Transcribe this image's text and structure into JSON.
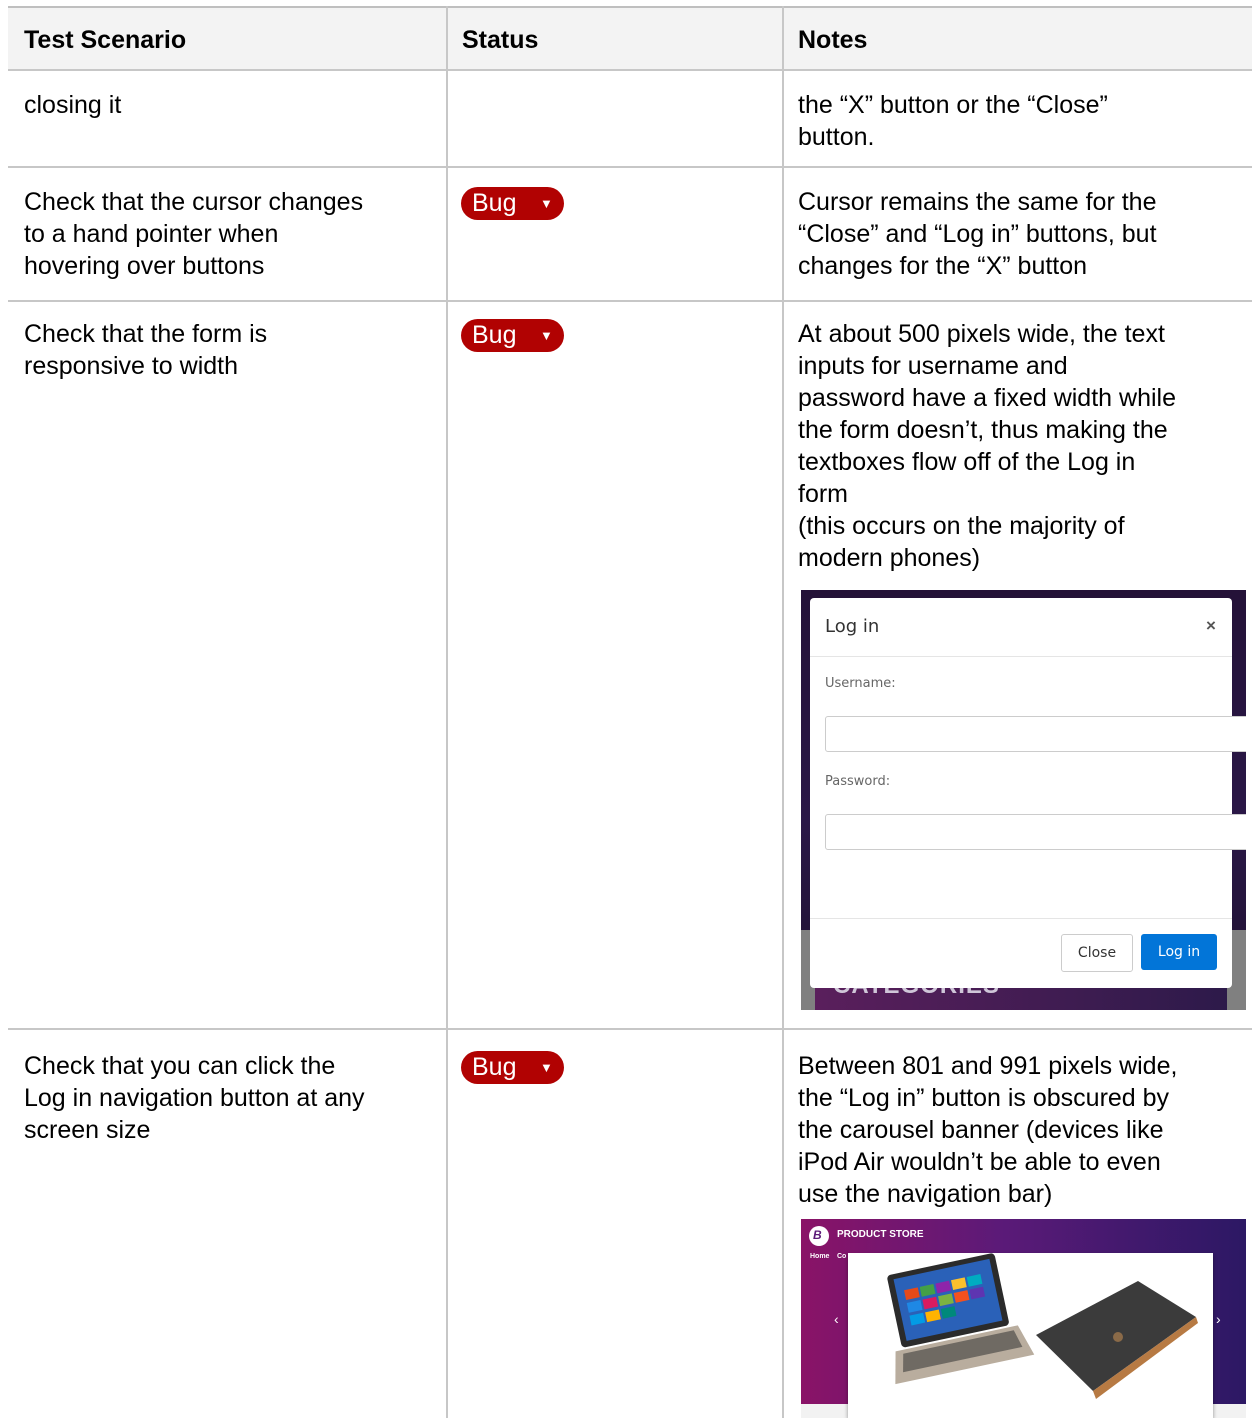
{
  "headers": [
    "Test Scenario",
    "Status",
    "Notes"
  ],
  "rows": [
    {
      "scenario": [
        "closing it"
      ],
      "status": "",
      "notes": [
        "the “X” button or the “Close”",
        "button."
      ]
    },
    {
      "scenario": [
        "Check that the cursor changes",
        "to a hand pointer when",
        "hovering over buttons"
      ],
      "status": "Bug",
      "notes": [
        "Cursor remains the same for the",
        "“Close” and “Log in” buttons, but",
        "changes for the “X” button"
      ]
    },
    {
      "scenario": [
        "Check that the form is",
        "responsive to width"
      ],
      "status": "Bug",
      "notes": [
        "At about 500 pixels wide, the text",
        "inputs for username and",
        "password have a fixed width while",
        "the form doesn’t, thus making the",
        "textboxes flow off of the Log in",
        "form",
        "(this occurs on the majority of",
        "modern phones)"
      ]
    },
    {
      "scenario": [
        "Check that you can click the",
        "Log in navigation button at any",
        "screen size"
      ],
      "status": "Bug",
      "notes": [
        "Between 801 and 991 pixels wide,",
        "the “Log in” button is obscured by",
        "the carousel banner (devices like",
        "iPod Air wouldn’t be able to even",
        "use the navigation bar)"
      ]
    }
  ],
  "status_color": "#b10202",
  "status_dropdown_icon": "caret-down-icon",
  "login_modal": {
    "title": "Log in",
    "close_glyph": "×",
    "username_label": "Username:",
    "password_label": "Password:",
    "close_button": "Close",
    "login_button": "Log in",
    "background_text": "CATEGORIES"
  },
  "store": {
    "logo_letter": "B",
    "title": "PRODUCT STORE",
    "nav_home": "Home",
    "nav_partial": "Co",
    "prev_glyph": "‹",
    "next_glyph": "›"
  }
}
